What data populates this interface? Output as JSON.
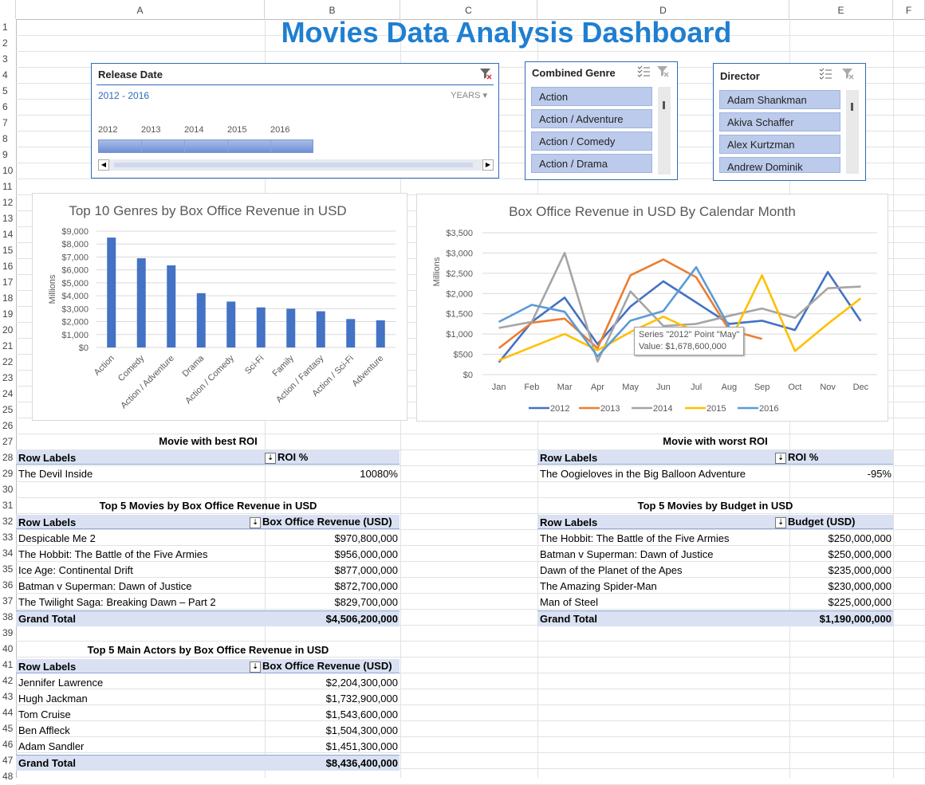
{
  "columns": [
    "A",
    "B",
    "C",
    "D",
    "E",
    "F"
  ],
  "rows": [
    "1",
    "2",
    "3",
    "4",
    "5",
    "6",
    "7",
    "8",
    "9",
    "10",
    "11",
    "12",
    "13",
    "14",
    "15",
    "16",
    "17",
    "18",
    "19",
    "20",
    "21",
    "22",
    "23",
    "24",
    "25",
    "26",
    "27",
    "28",
    "29",
    "30",
    "31",
    "32",
    "33",
    "34",
    "35",
    "36",
    "37",
    "38",
    "39",
    "40",
    "41",
    "42",
    "43",
    "44",
    "45",
    "46",
    "47",
    "48"
  ],
  "title": "Movies Data Analysis Dashboard",
  "release_slicer": {
    "title": "Release Date",
    "range": "2012 - 2016",
    "level": "YEARS",
    "years": [
      "2012",
      "2013",
      "2014",
      "2015",
      "2016"
    ]
  },
  "genre_slicer": {
    "title": "Combined Genre",
    "items": [
      "Action",
      "Action / Adventure",
      "Action / Comedy",
      "Action / Drama"
    ]
  },
  "director_slicer": {
    "title": "Director",
    "items": [
      "Adam Shankman",
      "Akiva Schaffer",
      "Alex Kurtzman",
      "Andrew Dominik"
    ]
  },
  "chart_data": [
    {
      "type": "bar",
      "title": "Top 10 Genres by Box Office Revenue in USD",
      "ylabel": "Millions",
      "categories": [
        "Action",
        "Comedy",
        "Action / Adventure",
        "Drama",
        "Action / Comedy",
        "Sci-Fi",
        "Family",
        "Action / Fantasy",
        "Action / Sci-Fi",
        "Adventure"
      ],
      "values": [
        8500,
        6900,
        6350,
        4200,
        3550,
        3100,
        3000,
        2800,
        2200,
        2100
      ],
      "yticks": [
        "$0",
        "$1,000",
        "$2,000",
        "$3,000",
        "$4,000",
        "$5,000",
        "$6,000",
        "$7,000",
        "$8,000",
        "$9,000"
      ],
      "ylim": [
        0,
        9000
      ],
      "color": "#4472c4"
    },
    {
      "type": "line",
      "title": "Box Office Revenue in USD By Calendar Month",
      "ylabel": "Millions",
      "categories": [
        "Jan",
        "Feb",
        "Mar",
        "Apr",
        "May",
        "Jun",
        "Jul",
        "Aug",
        "Sep",
        "Oct",
        "Nov",
        "Dec"
      ],
      "yticks": [
        "$0",
        "$500",
        "$1,000",
        "$1,500",
        "$2,000",
        "$2,500",
        "$3,000",
        "$3,500"
      ],
      "ylim": [
        0,
        3500
      ],
      "series": [
        {
          "name": "2012",
          "color": "#4472c4",
          "values": [
            300,
            1300,
            1900,
            750,
            1680,
            2300,
            1780,
            1250,
            1330,
            1100,
            2530,
            1320
          ]
        },
        {
          "name": "2013",
          "color": "#ed7d31",
          "values": [
            650,
            1280,
            1380,
            650,
            2450,
            2840,
            2400,
            1100,
            880,
            null,
            null,
            null
          ]
        },
        {
          "name": "2014",
          "color": "#a5a5a5",
          "values": [
            1150,
            1300,
            3000,
            320,
            2050,
            1200,
            1250,
            1450,
            1630,
            1400,
            2130,
            2170
          ]
        },
        {
          "name": "2015",
          "color": "#ffc000",
          "values": [
            350,
            680,
            1000,
            600,
            1050,
            1430,
            1050,
            780,
            2450,
            580,
            1250,
            1880
          ]
        },
        {
          "name": "2016",
          "color": "#5b9bd5",
          "values": [
            1300,
            1720,
            1550,
            450,
            1330,
            1570,
            2650,
            1180,
            null,
            null,
            null,
            null
          ]
        }
      ],
      "tooltip": {
        "line1": "Series \"2012\" Point \"May\"",
        "line2": "Value: $1,678,600,000"
      }
    }
  ],
  "best_roi": {
    "title": "Movie with best ROI",
    "col1": "Row Labels",
    "col2": "ROI %",
    "rows": [
      {
        "label": "The Devil Inside",
        "value": "10080%"
      }
    ]
  },
  "worst_roi": {
    "title": "Movie with worst ROI",
    "col1": "Row Labels",
    "col2": "ROI %",
    "rows": [
      {
        "label": "The Oogieloves in the Big Balloon Adventure",
        "value": "-95%"
      }
    ]
  },
  "top_box_office": {
    "title": "Top 5 Movies by Box Office Revenue in USD",
    "col1": "Row Labels",
    "col2": "Box Office Revenue (USD)",
    "rows": [
      {
        "label": "Despicable Me 2",
        "value": "$970,800,000"
      },
      {
        "label": "The Hobbit: The Battle of the Five Armies",
        "value": "$956,000,000"
      },
      {
        "label": "Ice Age: Continental Drift",
        "value": "$877,000,000"
      },
      {
        "label": "Batman v Superman: Dawn of Justice",
        "value": "$872,700,000"
      },
      {
        "label": "The Twilight Saga: Breaking Dawn – Part 2",
        "value": "$829,700,000"
      }
    ],
    "total_label": "Grand Total",
    "total_value": "$4,506,200,000"
  },
  "top_budget": {
    "title": "Top 5 Movies by Budget in USD",
    "col1": "Row Labels",
    "col2": "Budget (USD)",
    "rows": [
      {
        "label": "The Hobbit: The Battle of the Five Armies",
        "value": "$250,000,000"
      },
      {
        "label": "Batman v Superman: Dawn of Justice",
        "value": "$250,000,000"
      },
      {
        "label": "Dawn of the Planet of the Apes",
        "value": "$235,000,000"
      },
      {
        "label": "The Amazing Spider-Man",
        "value": "$230,000,000"
      },
      {
        "label": "Man of Steel",
        "value": "$225,000,000"
      }
    ],
    "total_label": "Grand Total",
    "total_value": "$1,190,000,000"
  },
  "top_actors": {
    "title": "Top 5 Main Actors by Box Office Revenue in USD",
    "col1": "Row Labels",
    "col2": "Box Office Revenue (USD)",
    "rows": [
      {
        "label": "Jennifer Lawrence",
        "value": "$2,204,300,000"
      },
      {
        "label": "Hugh Jackman",
        "value": "$1,732,900,000"
      },
      {
        "label": "Tom Cruise",
        "value": "$1,543,600,000"
      },
      {
        "label": "Ben Affleck",
        "value": "$1,504,300,000"
      },
      {
        "label": "Adam Sandler",
        "value": "$1,451,300,000"
      }
    ],
    "total_label": "Grand Total",
    "total_value": "$8,436,400,000"
  }
}
